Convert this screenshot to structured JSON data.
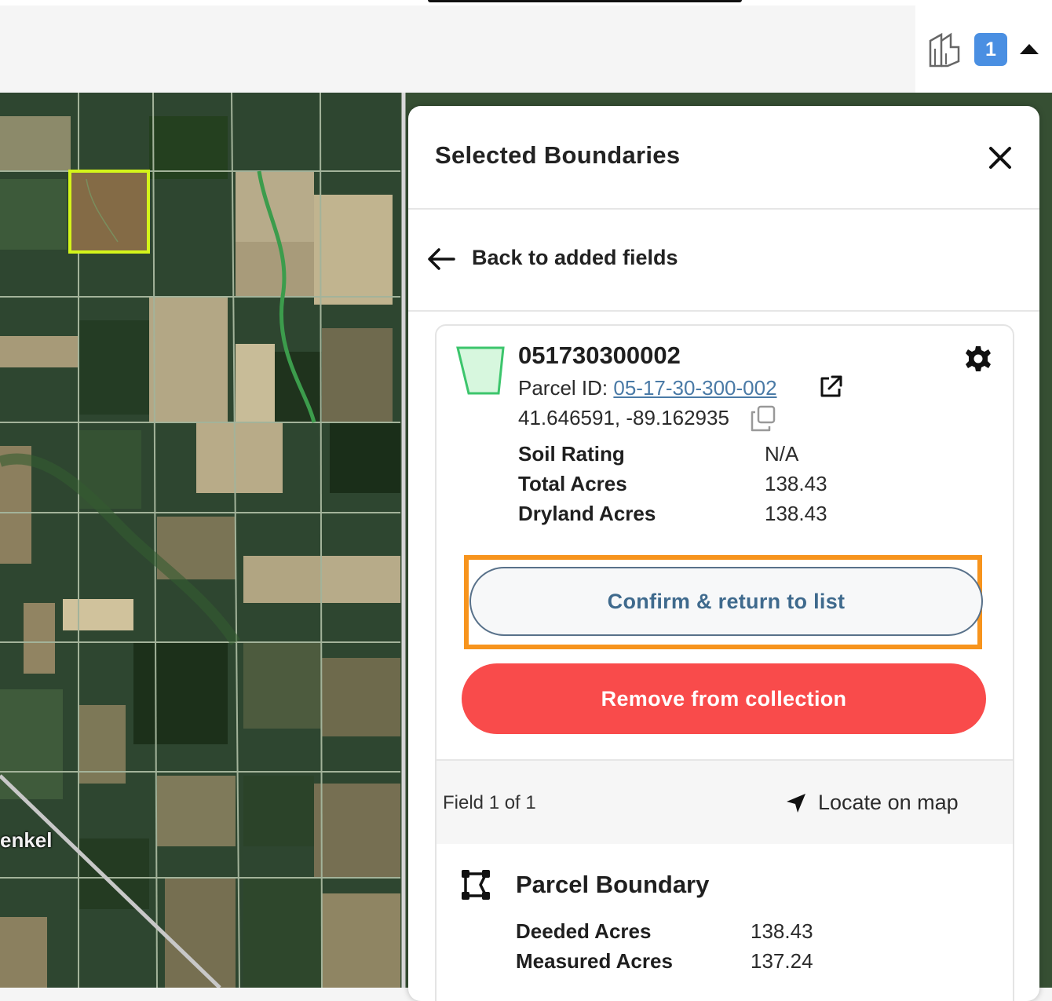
{
  "topbar": {
    "layer_count": "1"
  },
  "map": {
    "place_label": "enkel"
  },
  "panel": {
    "title": "Selected Boundaries",
    "back_label": "Back to added fields",
    "field": {
      "name": "051730300002",
      "parcel_label": "Parcel ID: ",
      "parcel_id": "05-17-30-300-002",
      "coordinates": "41.646591, -89.162935",
      "stats": [
        {
          "label": "Soil Rating",
          "value": "N/A"
        },
        {
          "label": "Total Acres",
          "value": "138.43"
        },
        {
          "label": "Dryland Acres",
          "value": "138.43"
        }
      ]
    },
    "confirm_label": "Confirm & return to list",
    "remove_label": "Remove from collection",
    "footer": {
      "field_count": "Field 1 of 1",
      "locate_label": "Locate on map"
    },
    "parcel_boundary": {
      "title": "Parcel Boundary",
      "stats": [
        {
          "label": "Deeded Acres",
          "value": "138.43"
        },
        {
          "label": "Measured Acres",
          "value": "137.24"
        }
      ]
    }
  },
  "colors": {
    "accent_blue": "#4a8fe2",
    "confirm_text": "#3f6a8d",
    "highlight_orange": "#f7941d",
    "remove_red": "#f94b4b",
    "selected_field": "#d4f51a"
  }
}
